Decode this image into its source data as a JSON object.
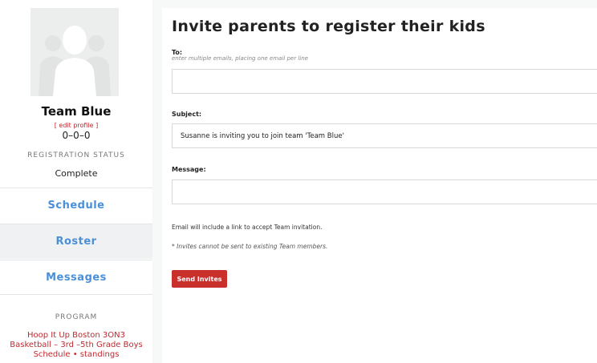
{
  "sidebar": {
    "team_name": "Team Blue",
    "edit_profile": "[ edit profile ]",
    "record": "0–0–0",
    "registration_status_label": "REGISTRATION STATUS",
    "registration_status_value": "Complete",
    "nav": {
      "schedule": "Schedule",
      "roster": "Roster",
      "messages": "Messages"
    },
    "program_label": "PROGRAM",
    "program_line1": "Hoop It Up Boston 3ON3",
    "program_line2": "Basketball – 3rd –5th Grade Boys",
    "program_schedule": "Schedule",
    "program_separator": "•",
    "program_standings": "standings"
  },
  "main": {
    "title": "Invite parents to register their kids",
    "to_label": "To:",
    "to_hint": "enter multiple emails, placing one email per line",
    "to_value": "",
    "subject_label": "Subject:",
    "subject_value": "Susanne is inviting you to join team 'Team Blue'",
    "message_label": "Message:",
    "message_value": "",
    "note1": "Email will include a link to accept Team invitation.",
    "note2": "* Invites cannot be sent to existing Team members.",
    "send_button": "Send Invites"
  },
  "colors": {
    "accent_red": "#c9302c",
    "nav_blue": "#4a90d9"
  }
}
